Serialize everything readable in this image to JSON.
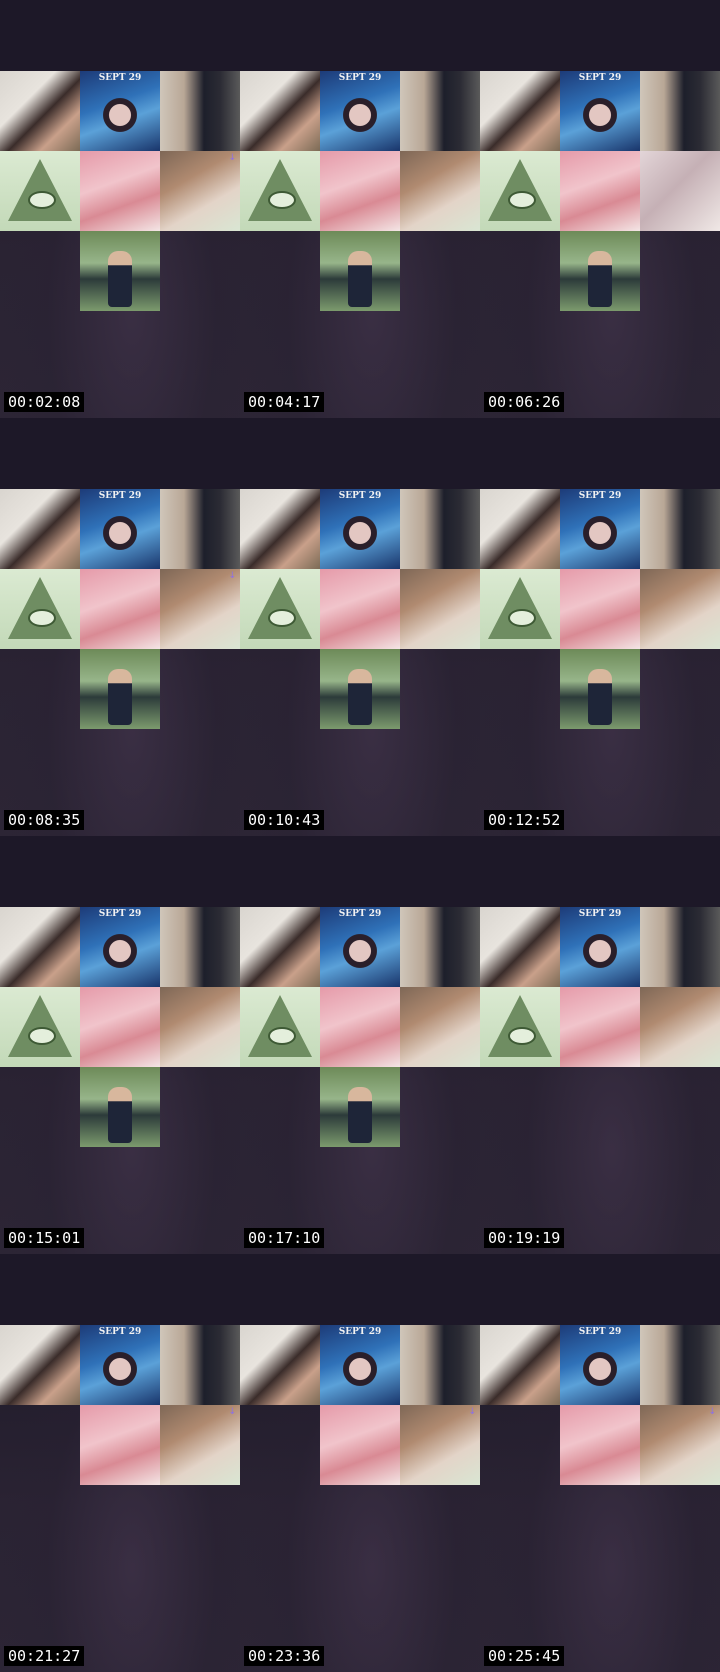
{
  "thumbnails": [
    {
      "timestamp": "00:02:08",
      "sept_label": "SEPT 29",
      "tiles": [
        "portrait",
        "sept",
        "portrait2",
        "pyramid",
        "pink",
        "girl",
        "green"
      ],
      "mic": true
    },
    {
      "timestamp": "00:04:17",
      "sept_label": "SEPT 29",
      "tiles": [
        "portrait",
        "sept",
        "portrait2",
        "pyramid",
        "pink",
        "girl",
        "green"
      ],
      "mic": false
    },
    {
      "timestamp": "00:06:26",
      "sept_label": "SEPT 29",
      "tiles": [
        "portrait",
        "sept",
        "portrait2",
        "pyramid",
        "pink",
        "room",
        "green"
      ],
      "mic": false
    },
    {
      "timestamp": "00:08:35",
      "sept_label": "SEPT 29",
      "tiles": [
        "portrait",
        "sept",
        "portrait2",
        "pyramid",
        "pink",
        "girl",
        "green"
      ],
      "mic": true
    },
    {
      "timestamp": "00:10:43",
      "sept_label": "SEPT 29",
      "tiles": [
        "portrait",
        "sept",
        "portrait2",
        "pyramid",
        "pink",
        "girl",
        "green"
      ],
      "mic": false
    },
    {
      "timestamp": "00:12:52",
      "sept_label": "SEPT 29",
      "tiles": [
        "portrait",
        "sept",
        "portrait2",
        "pyramid",
        "pink",
        "girl",
        "green"
      ],
      "mic": false
    },
    {
      "timestamp": "00:15:01",
      "sept_label": "SEPT 29",
      "tiles": [
        "portrait",
        "sept",
        "portrait2",
        "pyramid",
        "pink",
        "girl",
        "green"
      ],
      "mic": false
    },
    {
      "timestamp": "00:17:10",
      "sept_label": "SEPT 29",
      "tiles": [
        "portrait",
        "sept",
        "portrait2",
        "pyramid",
        "pink",
        "girl",
        "green"
      ],
      "mic": false
    },
    {
      "timestamp": "00:19:19",
      "sept_label": "SEPT 29",
      "tiles": [
        "portrait",
        "sept",
        "portrait2",
        "pyramid",
        "pink",
        "girl"
      ],
      "mic": false
    },
    {
      "timestamp": "00:21:27",
      "sept_label": "SEPT 29",
      "tiles": [
        "portrait",
        "sept",
        "portrait2",
        "pink",
        "girl"
      ],
      "mic": true
    },
    {
      "timestamp": "00:23:36",
      "sept_label": "SEPT 29",
      "tiles": [
        "portrait",
        "sept",
        "portrait2",
        "pink",
        "girl"
      ],
      "mic": true
    },
    {
      "timestamp": "00:25:45",
      "sept_label": "SEPT 29",
      "tiles": [
        "portrait",
        "sept",
        "portrait2",
        "pink",
        "girl"
      ],
      "mic": true
    }
  ],
  "icons": {
    "mic": "microphone-icon",
    "pyramid": "eye-of-providence-icon"
  },
  "colors": {
    "background": "#1e1a28",
    "timestamp_bg": "#000000",
    "timestamp_fg": "#ffffff",
    "mic": "#8d6fe8"
  }
}
